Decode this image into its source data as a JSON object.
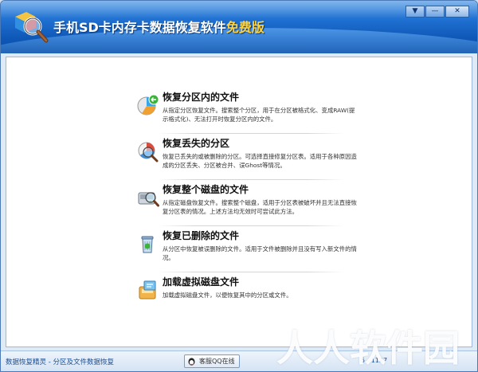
{
  "window": {
    "title_main": "手机SD卡内存卡数据恢复软件",
    "title_free": "免费版",
    "controls": {
      "menu": "▼",
      "minimize": "—",
      "close": "✕"
    }
  },
  "options": [
    {
      "title": "恢复分区内的文件",
      "desc": "从指定分区恢复文件。搜索整个分区，用于在分区被格式化、变成RAW(提示格式化)、无法打开时恢复分区内的文件。",
      "icon": "partition-recover-icon"
    },
    {
      "title": "恢复丢失的分区",
      "desc": "恢复已丢失的或被删除的分区。可选择直接修复分区表。适用于各种原因造成的分区丢失、分区被合并、误Ghost等情况。",
      "icon": "lost-partition-icon"
    },
    {
      "title": "恢复整个磁盘的文件",
      "desc": "从指定磁盘恢复文件。搜索整个磁盘，适用于分区表被破坏并且无法直接恢复分区表的情况。上述方法均无效时可尝试此方法。",
      "icon": "whole-disk-icon"
    },
    {
      "title": "恢复已删除的文件",
      "desc": "从分区中恢复被误删除的文件。适用于文件被删除并且没有写入新文件的情况。",
      "icon": "recycle-bin-icon"
    },
    {
      "title": "加载虚拟磁盘文件",
      "desc": "加载虚拟磁盘文件，以便恢复其中的分区或文件。",
      "icon": "virtual-disk-icon"
    }
  ],
  "statusbar": {
    "left_text": "数据恢复精灵 - 分区及文件数据恢复",
    "qq_label": "客服QQ在线",
    "right_text": "5. .1127"
  },
  "watermark": "人人软件园"
}
